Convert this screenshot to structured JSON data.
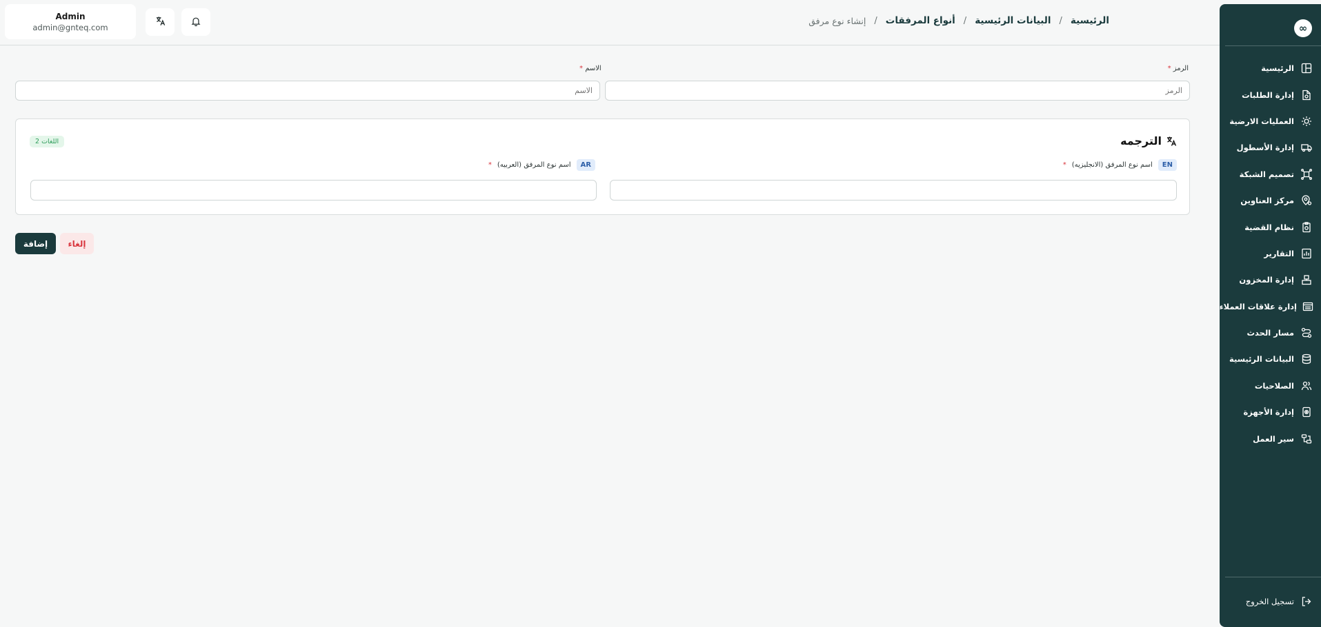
{
  "header": {
    "user": {
      "name": "Admin",
      "email": "admin@gnteq.com"
    },
    "breadcrumb": [
      "الرئيسية",
      "البيانات الرئيسية",
      "أنواع المرفقات",
      "إنشاء نوع مرفق"
    ],
    "separator": "/"
  },
  "sidebar": {
    "logo": "∞",
    "items": [
      {
        "label": "الرئيسية",
        "icon": "layout-icon"
      },
      {
        "label": "إدارة الطلبات",
        "icon": "file-icon"
      },
      {
        "label": "العمليات الارضية",
        "icon": "gear-icon"
      },
      {
        "label": "إدارة الأسطول",
        "icon": "truck-icon"
      },
      {
        "label": "تصميم الشبكة",
        "icon": "network-icon"
      },
      {
        "label": "مركز العناوين",
        "icon": "map-pin-icon"
      },
      {
        "label": "نظام القضية",
        "icon": "case-icon"
      },
      {
        "label": "التقارير",
        "icon": "report-icon"
      },
      {
        "label": "إدارة المخزون",
        "icon": "warehouse-icon"
      },
      {
        "label": "إدارة علاقات العملاء",
        "icon": "crm-icon"
      },
      {
        "label": "مسار الحدث",
        "icon": "route-icon"
      },
      {
        "label": "البيانات الرئيسية",
        "icon": "database-icon"
      },
      {
        "label": "الصلاحيات",
        "icon": "users-icon"
      },
      {
        "label": "إدارة الأجهزة",
        "icon": "device-icon"
      },
      {
        "label": "سير العمل",
        "icon": "workflow-icon"
      }
    ],
    "logout": "تسجيل الخروج"
  },
  "form": {
    "code": {
      "label": "الرمز",
      "placeholder": "الرمز",
      "required": "*"
    },
    "name": {
      "label": "الاسم",
      "placeholder": "الاسم",
      "required": "*"
    }
  },
  "translation": {
    "title": "الترجمه",
    "count_badge": "2 اللغات",
    "fields": [
      {
        "code": "EN",
        "label": "اسم نوع المرفق (الانجليزيه)",
        "required": "*"
      },
      {
        "code": "AR",
        "label": "اسم نوع المرفق (العربيه)",
        "required": "*"
      }
    ]
  },
  "actions": {
    "add": "إضافة",
    "cancel": "إلغاء"
  },
  "colors": {
    "primary": "#1b3b3d",
    "danger": "#d9363e",
    "success": "#2e9c5a",
    "background": "#f6f7f7"
  }
}
